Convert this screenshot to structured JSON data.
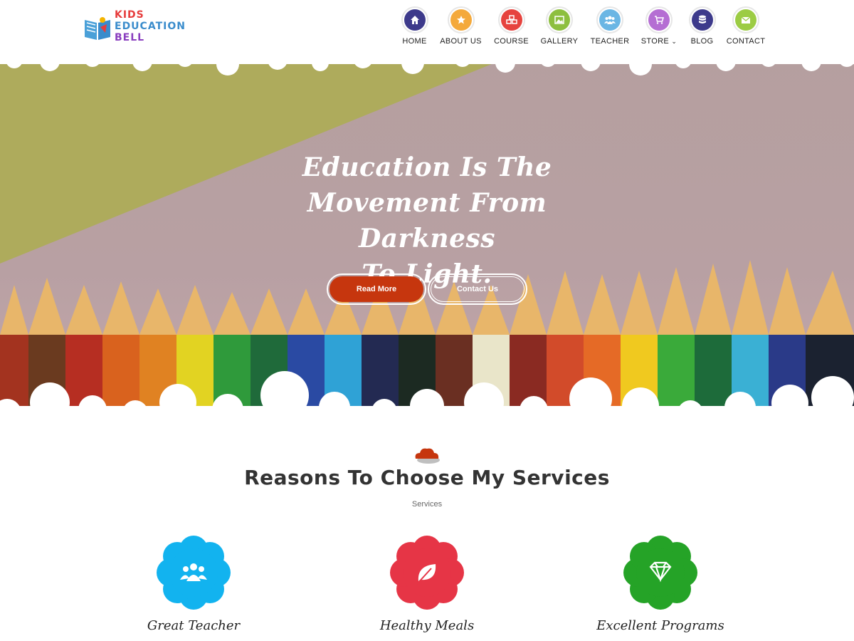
{
  "logo": {
    "line1": "KIDS",
    "line2": "EDUCATION",
    "line3": "BELL"
  },
  "nav": [
    {
      "label": "HOME",
      "icon": "home-icon",
      "color": "#3d3a8b"
    },
    {
      "label": "ABOUT US",
      "icon": "star-icon",
      "color": "#f4a93b"
    },
    {
      "label": "COURSE",
      "icon": "cubes-icon",
      "color": "#e6433e"
    },
    {
      "label": "GALLERY",
      "icon": "image-icon",
      "color": "#8dbf3f"
    },
    {
      "label": "TEACHER",
      "icon": "users-icon",
      "color": "#6bb6e4"
    },
    {
      "label": "STORE",
      "icon": "cart-icon",
      "color": "#b56ed3",
      "dropdown": true
    },
    {
      "label": "BLOG",
      "icon": "database-icon",
      "color": "#3d3a8b"
    },
    {
      "label": "CONTACT",
      "icon": "envelope-icon",
      "color": "#9ccc44"
    }
  ],
  "hero": {
    "title_line1": "Education Is The",
    "title_line2": "Movement From Darkness",
    "title_line3": "To Light.",
    "read_more": "Read More",
    "contact_us": "Contact Us"
  },
  "services": {
    "title": "Reasons To Choose My Services",
    "subtitle": "Services",
    "items": [
      {
        "name": "Great Teacher",
        "icon": "users-icon",
        "color": "#12b3ef"
      },
      {
        "name": "Healthy Meals",
        "icon": "leaf-icon",
        "color": "#e63546"
      },
      {
        "name": "Excellent Programs",
        "icon": "diamond-icon",
        "color": "#25a327"
      }
    ]
  }
}
